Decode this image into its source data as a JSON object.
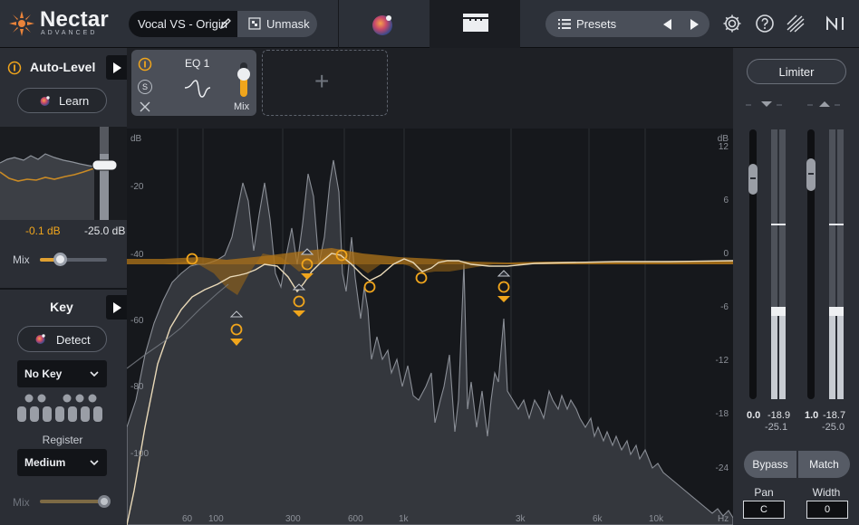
{
  "header": {
    "logo_title": "Nectar",
    "logo_subtitle": "ADVANCED",
    "preset_name": "Vocal VS - Origin",
    "unmask_label": "Unmask",
    "presets_label": "Presets"
  },
  "auto_level": {
    "title": "Auto-Level",
    "learn_label": "Learn",
    "input_value": "-0.1 dB",
    "output_value": "-25.0 dB",
    "mix_label": "Mix",
    "mix_level": 0.3
  },
  "key": {
    "title": "Key",
    "detect_label": "Detect",
    "key_value": "No Key",
    "register_label": "Register",
    "register_value": "Medium",
    "mix_label": "Mix",
    "mix_level": 1.0
  },
  "module": {
    "title": "EQ 1",
    "solo_label": "S",
    "mix_label": "Mix",
    "mix_level": 0.65
  },
  "eq": {
    "left_axis": [
      "dB",
      "-20",
      "-40",
      "-60",
      "-80",
      "-100"
    ],
    "right_axis": [
      "dB",
      "12",
      "6",
      "0",
      "-6",
      "-12",
      "-18",
      "-24"
    ],
    "freq_labels": [
      "60",
      "100",
      "300",
      "600",
      "1k",
      "3k",
      "6k",
      "10k",
      "Hz"
    ]
  },
  "right_panel": {
    "limiter_label": "Limiter",
    "in_peak": "0.0",
    "in_rms_a": "-18.9",
    "in_rms_b": "-25.1",
    "out_peak": "1.0",
    "out_rms_a": "-18.7",
    "out_rms_b": "-25.0",
    "bypass_label": "Bypass",
    "match_label": "Match",
    "pan_label": "Pan",
    "pan_value": "C",
    "width_label": "Width",
    "width_value": "0"
  },
  "colors": {
    "accent": "#f0a51c",
    "background": "#1e2025",
    "panel": "#2b2e35"
  }
}
